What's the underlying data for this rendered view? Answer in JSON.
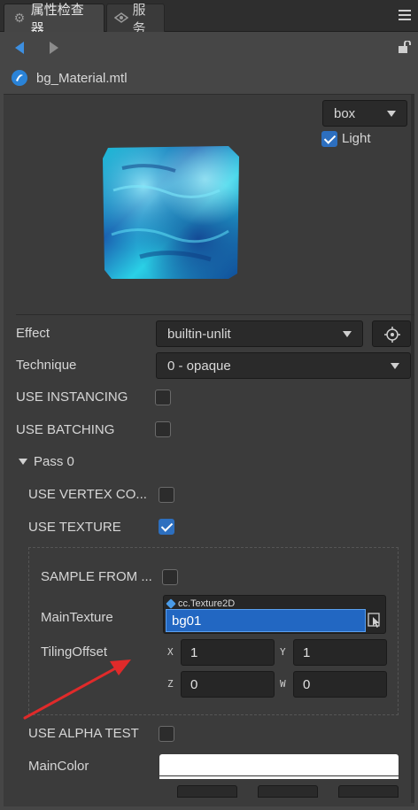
{
  "tabs": [
    {
      "label": "属性检查器",
      "icon": "gear-icon"
    },
    {
      "label": "服务",
      "icon": "eye-icon"
    }
  ],
  "file": {
    "name": "bg_Material.mtl",
    "icon": "material-icon"
  },
  "preview": {
    "shape_select": "box",
    "light_label": "Light",
    "light_checked": true
  },
  "properties": {
    "effect": {
      "label": "Effect",
      "value": "builtin-unlit"
    },
    "technique": {
      "label": "Technique",
      "value": "0 - opaque"
    },
    "use_instancing": {
      "label": "USE INSTANCING",
      "checked": false
    },
    "use_batching": {
      "label": "USE BATCHING",
      "checked": false
    }
  },
  "pass": {
    "label": "Pass 0",
    "use_vertex_color": {
      "label": "USE VERTEX CO...",
      "checked": false
    },
    "use_texture": {
      "label": "USE TEXTURE",
      "checked": true
    },
    "sample_from": {
      "label": "SAMPLE FROM ...",
      "checked": false
    },
    "main_texture": {
      "label": "MainTexture",
      "type": "cc.Texture2D",
      "value": "bg01"
    },
    "tiling_offset": {
      "label": "TilingOffset",
      "x_label": "X",
      "x": "1",
      "y_label": "Y",
      "y": "1",
      "z_label": "Z",
      "z": "0",
      "w_label": "W",
      "w": "0"
    },
    "use_alpha_test": {
      "label": "USE ALPHA TEST",
      "checked": false
    },
    "main_color": {
      "label": "MainColor",
      "color": "#ffffff"
    }
  },
  "colors": {
    "accent": "#2d6fbf",
    "annotation_arrow": "#e02a2a"
  }
}
